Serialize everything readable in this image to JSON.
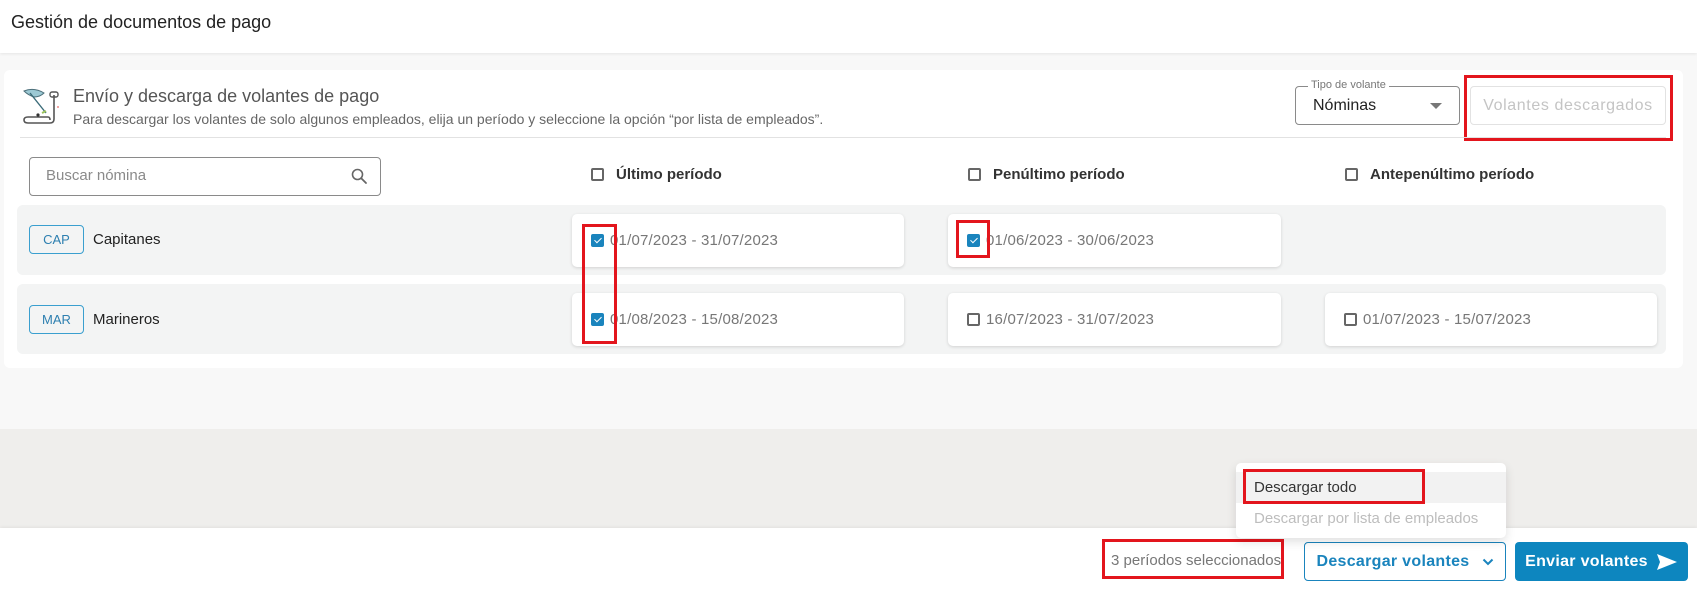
{
  "header": {
    "title": "Gestión de documentos de pago"
  },
  "section": {
    "icon": "document-quill-icon",
    "title": "Envío y descarga de volantes de pago",
    "description": "Para descargar los volantes de solo algunos empleados, elija un período y seleccione la opción “por lista de empleados”."
  },
  "voucher_type": {
    "label": "Tipo de volante",
    "value": "Nóminas"
  },
  "downloaded_button": {
    "label": "Volantes descargados",
    "disabled": true
  },
  "search": {
    "placeholder": "Buscar nómina",
    "value": ""
  },
  "columns": [
    {
      "label": "Último período",
      "checked": false
    },
    {
      "label": "Penúltimo período",
      "checked": false
    },
    {
      "label": "Antepenúltimo período",
      "checked": false
    }
  ],
  "rows": [
    {
      "code": "CAP",
      "name": "Capitanes",
      "periods": [
        {
          "range": "01/07/2023 - 31/07/2023",
          "checked": true
        },
        {
          "range": "01/06/2023 - 30/06/2023",
          "checked": true
        },
        null
      ]
    },
    {
      "code": "MAR",
      "name": "Marineros",
      "periods": [
        {
          "range": "01/08/2023 - 15/08/2023",
          "checked": true
        },
        {
          "range": "16/07/2023 - 31/07/2023",
          "checked": false
        },
        {
          "range": "01/07/2023 - 15/07/2023",
          "checked": false
        }
      ]
    }
  ],
  "download_menu": {
    "items": [
      {
        "label": "Descargar todo",
        "active": true,
        "disabled": false
      },
      {
        "label": "Descargar por lista de empleados",
        "active": false,
        "disabled": true
      }
    ]
  },
  "footer": {
    "selected_count": "3 períodos seleccionados",
    "download_button": "Descargar volantes",
    "send_button": "Enviar volantes"
  },
  "colors": {
    "primary": "#0d86bf",
    "checkbox_checked": "#1a84bd",
    "highlight": "#e3151d"
  }
}
